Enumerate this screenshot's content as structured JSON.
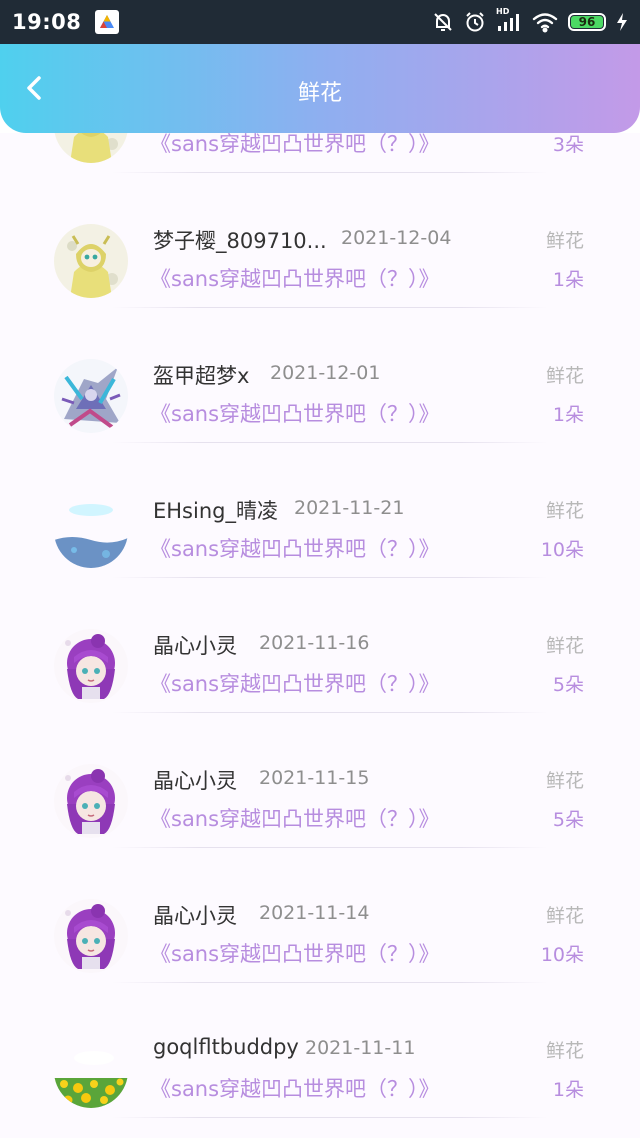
{
  "status_bar": {
    "time": "19:08",
    "network_label": "HD",
    "battery": "96",
    "icons": [
      "app-icon",
      "bell-muted-icon",
      "alarm-icon",
      "signal-icon",
      "wifi-icon",
      "battery-icon",
      "charging-icon"
    ]
  },
  "header": {
    "title": "鲜花",
    "back_icon": "chevron-left-icon",
    "gradient": [
      "#4fd0ee",
      "#8eaff0",
      "#c39ae8"
    ]
  },
  "colors": {
    "accent_purple": "#b78ddf",
    "name_text": "#333333",
    "date_text": "#8e8e8e",
    "muted_text": "#b8b8b8"
  },
  "items": [
    {
      "user": "",
      "date": "",
      "work": "《sans穿越凹凸世界吧（？）》",
      "type": "",
      "count": "3朵",
      "avatar": "yellow-raincoat-character"
    },
    {
      "user": "梦子樱_809710...",
      "date": "2021-12-04",
      "work": "《sans穿越凹凸世界吧（？）》",
      "type": "鲜花",
      "count": "1朵",
      "avatar": "yellow-raincoat-character"
    },
    {
      "user": "盔甲超梦x",
      "date": "2021-12-01",
      "work": "《sans穿越凹凸世界吧（？）》",
      "type": "鲜花",
      "count": "1朵",
      "avatar": "armored-mewtwo"
    },
    {
      "user": "EHsing_晴凌",
      "date": "2021-11-21",
      "work": "《sans穿越凹凸世界吧（？）》",
      "type": "鲜花",
      "count": "10朵",
      "avatar": "blue-ocean"
    },
    {
      "user": "晶心小灵",
      "date": "2021-11-16",
      "work": "《sans穿越凹凸世界吧（？）》",
      "type": "鲜花",
      "count": "5朵",
      "avatar": "purple-hair-girl"
    },
    {
      "user": "晶心小灵",
      "date": "2021-11-15",
      "work": "《sans穿越凹凸世界吧（？）》",
      "type": "鲜花",
      "count": "5朵",
      "avatar": "purple-hair-girl"
    },
    {
      "user": "晶心小灵",
      "date": "2021-11-14",
      "work": "《sans穿越凹凸世界吧（？）》",
      "type": "鲜花",
      "count": "10朵",
      "avatar": "purple-hair-girl"
    },
    {
      "user": "goqlfltbuddpy",
      "date": "2021-11-11",
      "work": "《sans穿越凹凸世界吧（？）》",
      "type": "鲜花",
      "count": "1朵",
      "avatar": "dandelion-field"
    }
  ]
}
